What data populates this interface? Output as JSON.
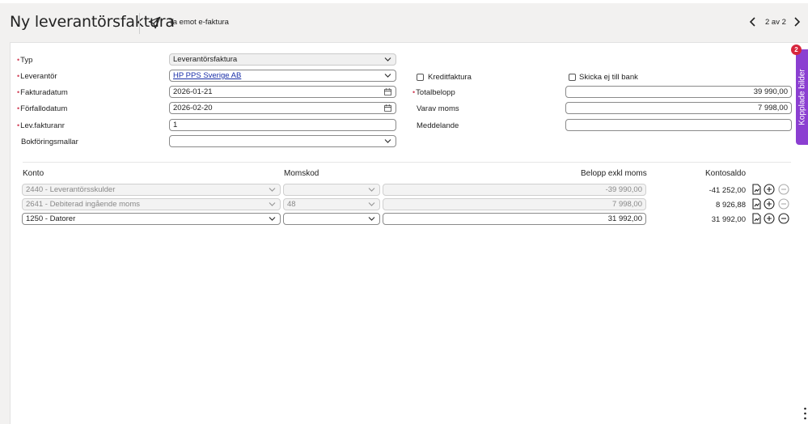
{
  "header": {
    "title": "Ny leverantörsfaktura",
    "efaktura_label": "Ta emot e-faktura",
    "pager": "2 av 2"
  },
  "form": {
    "typ": {
      "label": "Typ",
      "value": "Leverantörsfaktura"
    },
    "leverantor": {
      "label": "Leverantör",
      "value": "HP PPS Sverige AB"
    },
    "fakturadatum": {
      "label": "Fakturadatum",
      "value": "2026-01-21"
    },
    "forfallodatum": {
      "label": "Förfallodatum",
      "value": "2026-02-20"
    },
    "levfakturanr": {
      "label": "Lev.fakturanr",
      "value": "1"
    },
    "bokforingsmallar": {
      "label": "Bokföringsmallar",
      "value": ""
    },
    "kreditfaktura": {
      "label": "Kreditfaktura",
      "checked": false
    },
    "skicka_ej": {
      "label": "Skicka ej till bank",
      "checked": false
    },
    "totalbelopp": {
      "label": "Totalbelopp",
      "value": "39 990,00"
    },
    "varav_moms": {
      "label": "Varav moms",
      "value": "7 998,00"
    },
    "meddelande": {
      "label": "Meddelande",
      "value": ""
    }
  },
  "table": {
    "headers": {
      "konto": "Konto",
      "momskod": "Momskod",
      "belopp": "Belopp exkl moms",
      "kontosaldo": "Kontosaldo"
    },
    "rows": [
      {
        "konto": "2440 - Leverantörsskulder",
        "momskod": "",
        "belopp": "-39 990,00",
        "saldo": "-41 252,00",
        "editable": false
      },
      {
        "konto": "2641 - Debiterad ingående moms",
        "momskod": "48",
        "belopp": "7 998,00",
        "saldo": "8 926,88",
        "editable": false
      },
      {
        "konto": "1250 - Datorer",
        "momskod": "",
        "belopp": "31 992,00",
        "saldo": "31 992,00",
        "editable": true
      }
    ]
  },
  "side_panel": {
    "label": "Kopplade bilder",
    "badge": "2"
  },
  "colors": {
    "accent": "#8b3fd1",
    "required": "#d2435a",
    "badge": "#d7263d",
    "link": "#1a2fa8"
  }
}
